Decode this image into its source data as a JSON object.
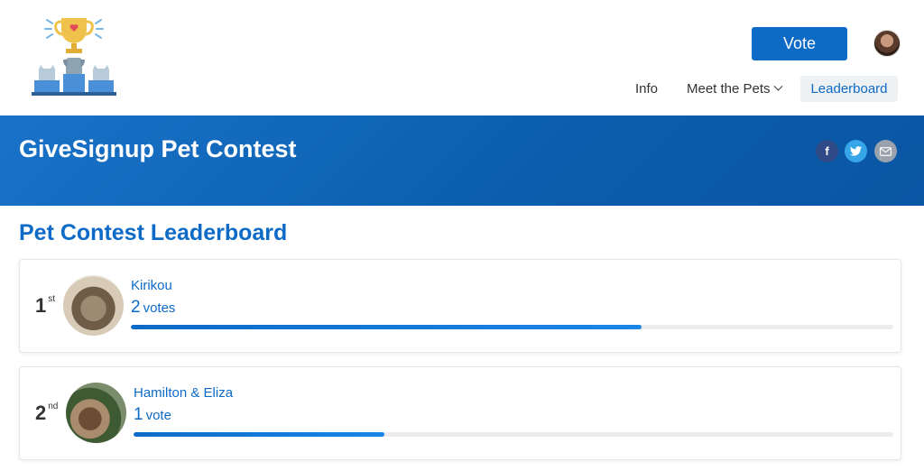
{
  "header": {
    "logo": "pet-contest-trophy-logo",
    "vote_label": "Vote",
    "nav": {
      "info": "Info",
      "meet_pets": "Meet the Pets",
      "leaderboard": "Leaderboard"
    }
  },
  "banner": {
    "title": "GiveSignup Pet Contest",
    "social": [
      "facebook-icon",
      "twitter-icon",
      "email-icon"
    ]
  },
  "leaderboard": {
    "title": "Pet Contest Leaderboard",
    "entries": [
      {
        "rank": "1",
        "suffix": "st",
        "name": "Kirikou",
        "votes": "2",
        "vote_word": "votes",
        "progress": 0.67
      },
      {
        "rank": "2",
        "suffix": "nd",
        "name": "Hamilton & Eliza",
        "votes": "1",
        "vote_word": "vote",
        "progress": 0.33
      }
    ]
  },
  "colors": {
    "brand_blue": "#0d6ac7",
    "banner_blue": "#0b5fae",
    "nav_active_bg": "#eef1f4"
  }
}
